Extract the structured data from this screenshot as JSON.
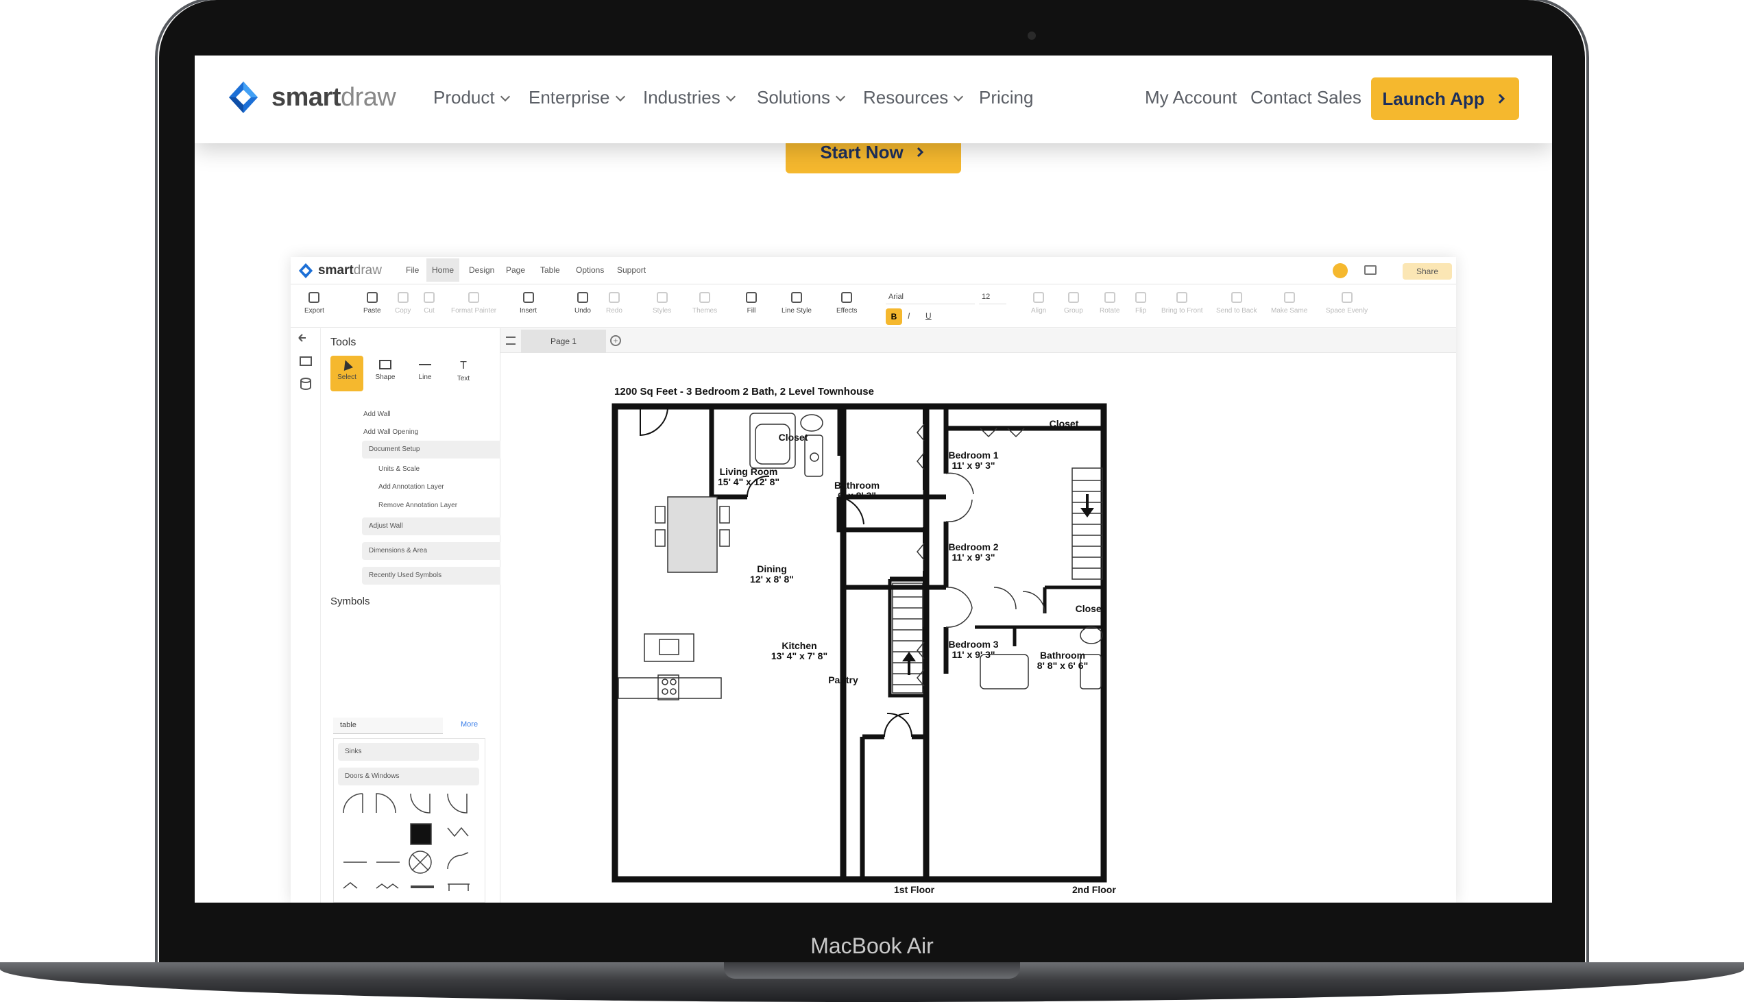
{
  "brand": {
    "name_bold": "smart",
    "name_light": "draw"
  },
  "nav": {
    "items": [
      "Product",
      "Enterprise",
      "Industries",
      "Solutions",
      "Resources",
      "Pricing"
    ],
    "my_account": "My Account",
    "contact_sales": "Contact Sales",
    "launch_app": "Launch App"
  },
  "hero": {
    "start_now": "Start Now"
  },
  "device": {
    "label": "MacBook Air"
  },
  "app": {
    "logo_bold": "smart",
    "logo_light": "draw",
    "menu": [
      "File",
      "Home",
      "Design",
      "Page",
      "Table",
      "Options",
      "Support"
    ],
    "share": "Share",
    "ribbon": {
      "export": "Export",
      "paste": "Paste",
      "copy": "Copy",
      "cut": "Cut",
      "format_painter": "Format Painter",
      "insert": "Insert",
      "undo": "Undo",
      "redo": "Redo",
      "styles": "Styles",
      "themes": "Themes",
      "fill": "Fill",
      "line_style": "Line Style",
      "effects": "Effects",
      "font": "Arial",
      "font_size": "12",
      "bold": "B",
      "italic": "I",
      "underline": "U",
      "align": "Align",
      "group": "Group",
      "rotate": "Rotate",
      "flip": "Flip",
      "bring_front": "Bring to Front",
      "send_back": "Send to Back",
      "make_same": "Make Same",
      "space_evenly": "Space Evenly"
    },
    "panel": {
      "tools_title": "Tools",
      "tools": [
        "Select",
        "Shape",
        "Line",
        "Text"
      ],
      "add_wall": "Add Wall",
      "add_wall_opening": "Add Wall Opening",
      "document_setup": "Document Setup",
      "units_scale": "Units & Scale",
      "add_annotation": "Add Annotation Layer",
      "remove_annotation": "Remove Annotation Layer",
      "adjust_wall": "Adjust Wall",
      "dimensions_area": "Dimensions & Area",
      "recent_symbols": "Recently Used Symbols",
      "symbols_title": "Symbols",
      "search_value": "table",
      "more": "More",
      "lib_sinks": "Sinks",
      "lib_doors": "Doors & Windows"
    },
    "page_tab": "Page 1",
    "floorplan": {
      "title": "1200 Sq Feet - 3 Bedroom 2 Bath, 2 Level Townhouse",
      "first_floor": "1st Floor",
      "second_floor": "2nd Floor",
      "rooms1": [
        {
          "name": "Closet",
          "dim": ""
        },
        {
          "name": "Living Room",
          "dim": "15' 4\" x 12' 8\""
        },
        {
          "name": "Bathroom",
          "dim": "6' x 8' 3\""
        },
        {
          "name": "Dining",
          "dim": "12' x 8' 8\""
        },
        {
          "name": "Kitchen",
          "dim": "13' 4\" x 7' 8\""
        },
        {
          "name": "Pantry",
          "dim": ""
        }
      ],
      "rooms2": [
        {
          "name": "Closet",
          "dim": ""
        },
        {
          "name": "Bedroom 1",
          "dim": "11' x 9' 3\""
        },
        {
          "name": "Bedroom 2",
          "dim": "11' x 9' 3\""
        },
        {
          "name": "Closet",
          "dim": ""
        },
        {
          "name": "Bedroom 3",
          "dim": "11' x 9' 3\""
        },
        {
          "name": "Bathroom",
          "dim": "8' 8\" x 6' 6\""
        }
      ]
    }
  },
  "colors": {
    "accent": "#f5b82e",
    "brand_blue": "#1c6fd6",
    "nav_text": "#5b5f66"
  }
}
